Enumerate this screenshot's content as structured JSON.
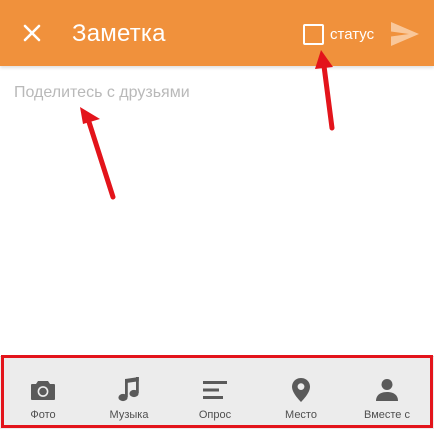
{
  "header": {
    "title": "Заметка",
    "status_label": "статус",
    "status_checked": false,
    "background_color": "#f0913c"
  },
  "icons": {
    "close": "close-icon",
    "checkbox": "checkbox-icon",
    "send": "send-icon"
  },
  "composer": {
    "placeholder": "Поделитесь с друзьями",
    "value": ""
  },
  "toolbar": {
    "items": [
      {
        "label": "Фото",
        "icon": "camera-icon"
      },
      {
        "label": "Музыка",
        "icon": "music-note-icon"
      },
      {
        "label": "Опрос",
        "icon": "poll-icon"
      },
      {
        "label": "Место",
        "icon": "location-pin-icon"
      },
      {
        "label": "Вместе с",
        "icon": "person-icon"
      }
    ]
  },
  "annotations": {
    "arrow_color": "#e3141b"
  }
}
